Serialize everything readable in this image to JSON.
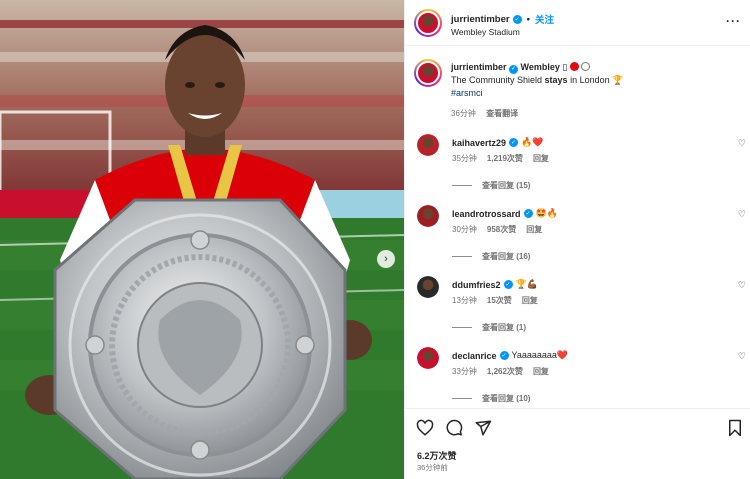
{
  "post": {
    "author": "jurrientimber",
    "follow_label": "关注",
    "location": "Wembley Stadium",
    "dot": "•",
    "more_icon": "more-horizontal-icon"
  },
  "caption": {
    "author": "jurrientimber",
    "location_tag": "Wembley",
    "icon_box": "▯",
    "text_before": "The Community Shield ",
    "text_bold": "stays",
    "text_after": " in London ",
    "trophy": "🏆",
    "hashtag": "#arsmci",
    "time": "36分钟",
    "translate_label": "查看翻译"
  },
  "comments": [
    {
      "user": "kaihavertz29",
      "text": "🔥❤️",
      "time": "35分钟",
      "likes": "1,219次赞",
      "reply_label": "回复",
      "view_replies": "查看回复 (15)",
      "avatar_color": "#b8232a"
    },
    {
      "user": "leandrotrossard",
      "text": "🤩🔥",
      "time": "30分钟",
      "likes": "958次赞",
      "reply_label": "回复",
      "view_replies": "查看回复 (16)",
      "avatar_color": "#9c1e22"
    },
    {
      "user": "ddumfries2",
      "text": "🏆💪🏾",
      "time": "13分钟",
      "likes": "15次赞",
      "reply_label": "回复",
      "view_replies": "查看回复 (1)",
      "avatar_color": "#2a2a2a"
    },
    {
      "user": "declanrice",
      "text": "Yaaaaaaaa❤️",
      "time": "33分钟",
      "likes": "1,262次赞",
      "reply_label": "回复",
      "view_replies": "查看回复 (10)",
      "avatar_color": "#c8102e"
    }
  ],
  "footer": {
    "likes": "6.2万次赞",
    "time": "36分钟前"
  },
  "colors": {
    "link_blue": "#0095f6",
    "hashtag": "#00376b",
    "arsenal_red": "#e30613"
  }
}
